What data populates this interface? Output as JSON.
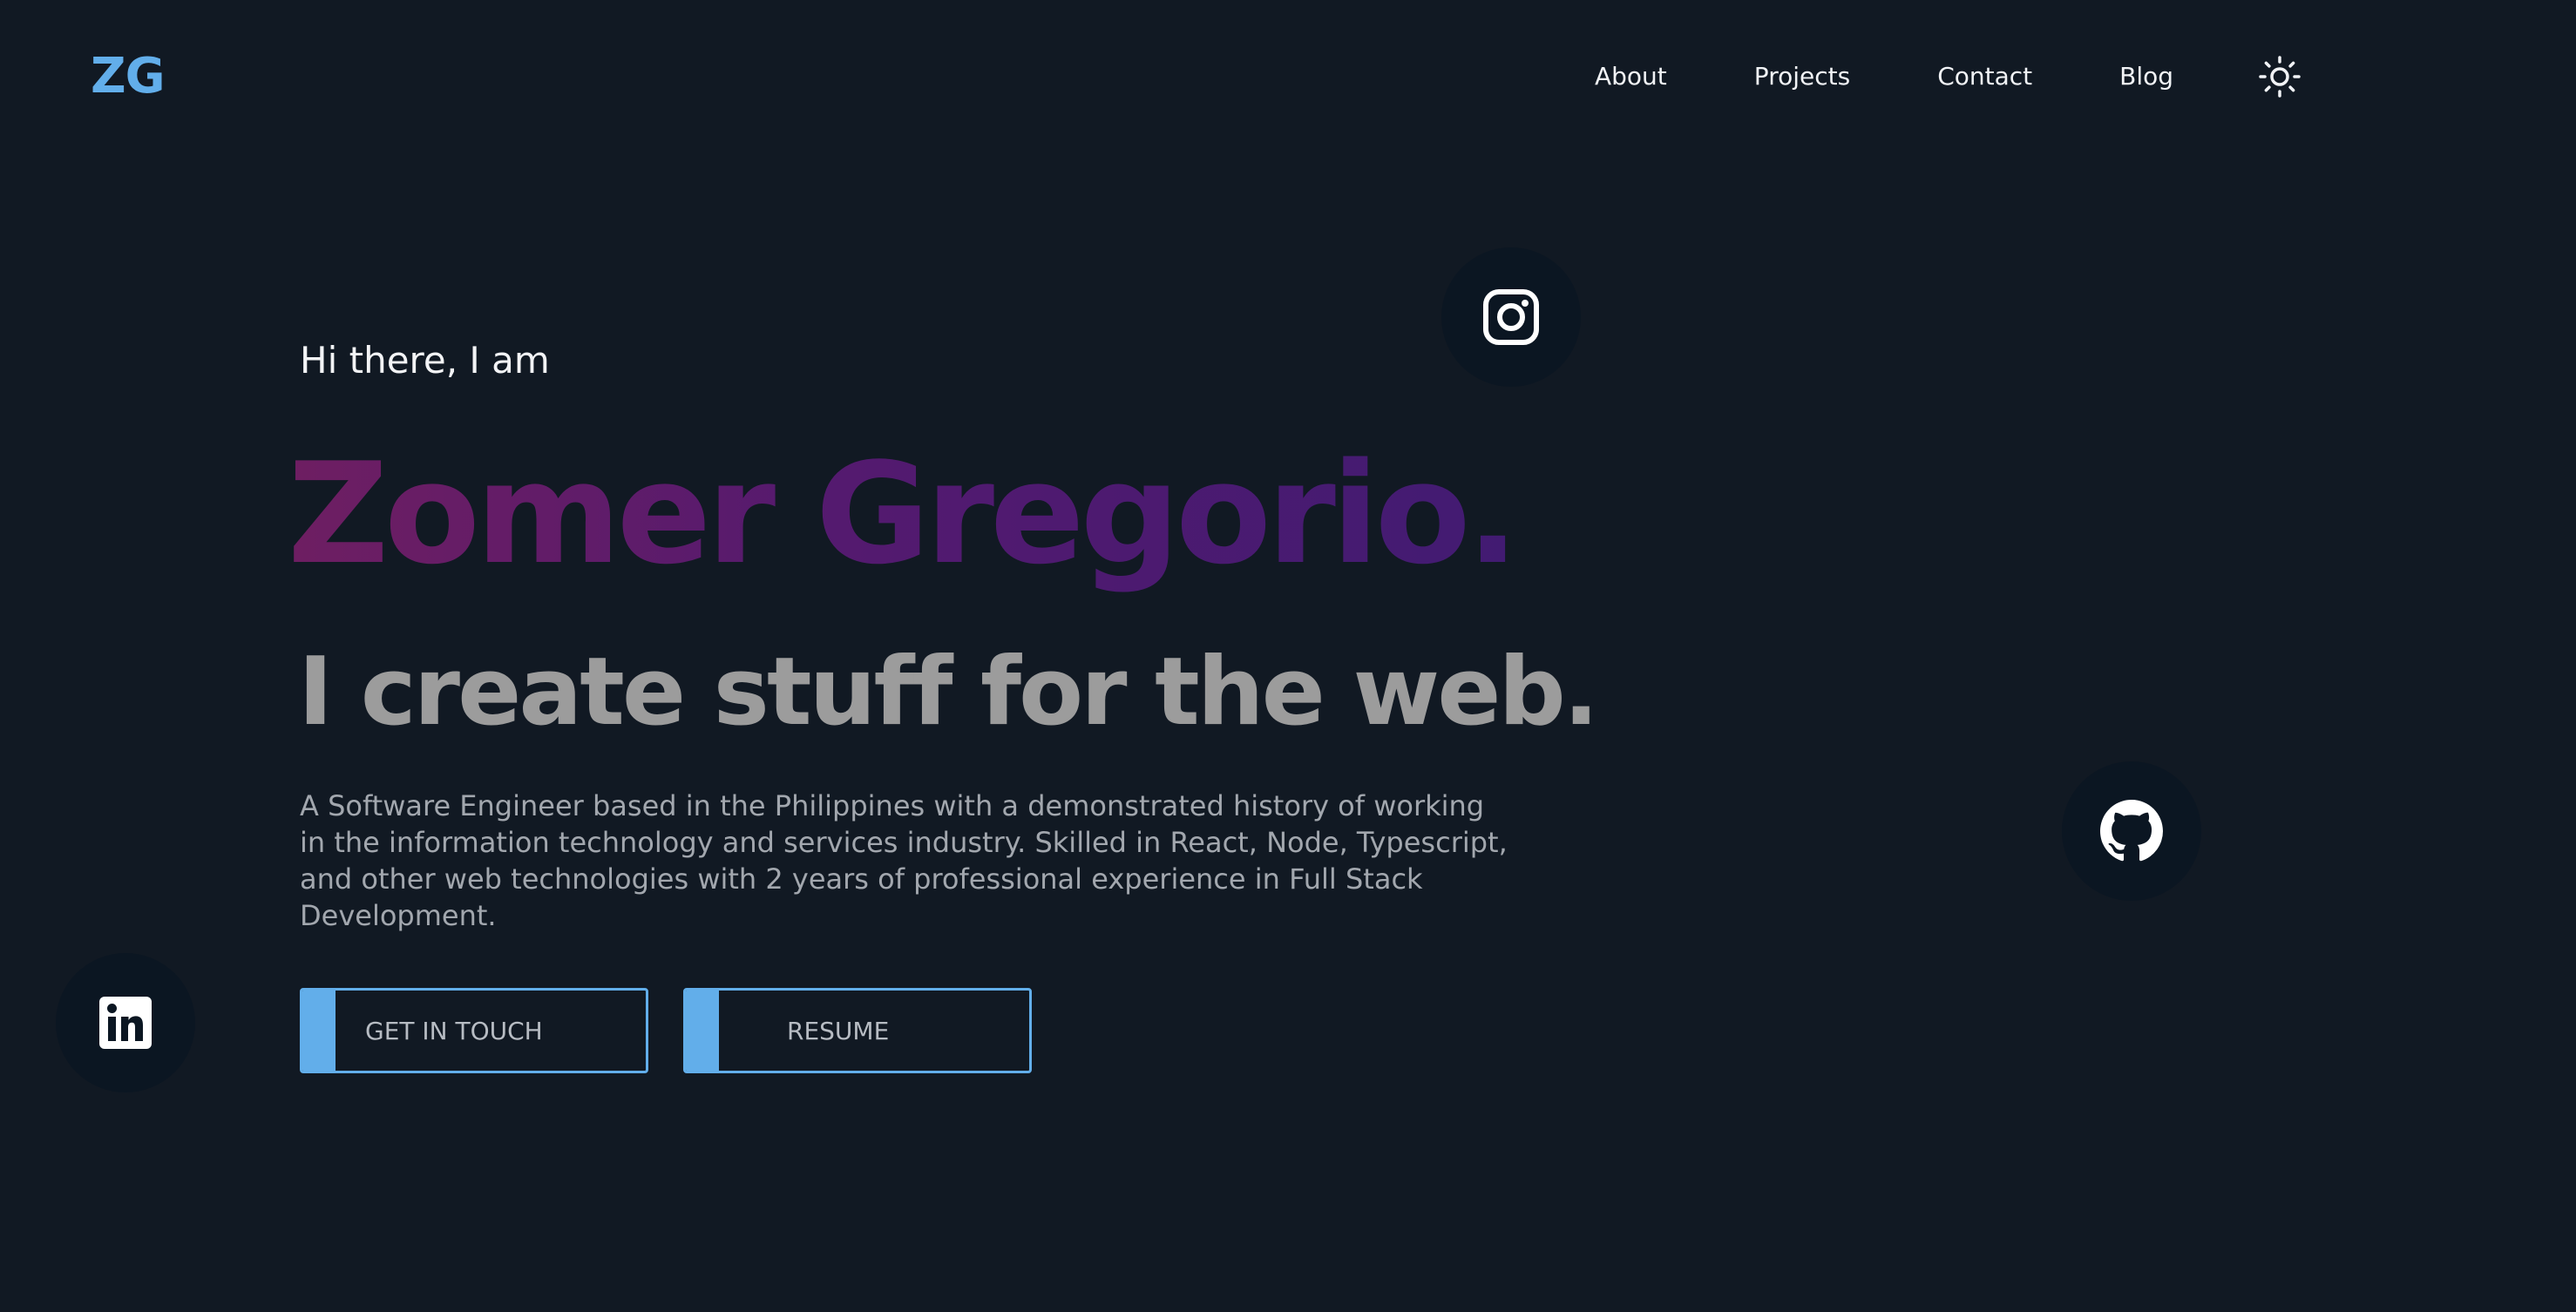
{
  "header": {
    "logo": "ZG",
    "nav": [
      {
        "label": "About"
      },
      {
        "label": "Projects"
      },
      {
        "label": "Contact"
      },
      {
        "label": "Blog"
      }
    ],
    "theme_icon": "sun-icon"
  },
  "hero": {
    "greeting": "Hi there, I am",
    "name": "Zomer Gregorio.",
    "tagline": "I create stuff for the web.",
    "bio": "A Software Engineer based in the Philippines with a demonstrated history of working in the information technology and services industry. Skilled in React, Node, Typescript, and other web technologies with 2 years of professional experience in Full Stack Development.",
    "buttons": {
      "contact_label": "GET IN TOUCH",
      "resume_label": "RESUME"
    }
  },
  "social": {
    "instagram_icon": "instagram-icon",
    "github_icon": "github-icon",
    "linkedin_icon": "linkedin-icon"
  },
  "colors": {
    "background": "#111923",
    "accent": "#62aeea",
    "name_gradient_start": "#6e1e62",
    "name_gradient_end": "#421b72",
    "tagline": "#9c9c9c",
    "social_circle": "#0b1622"
  }
}
